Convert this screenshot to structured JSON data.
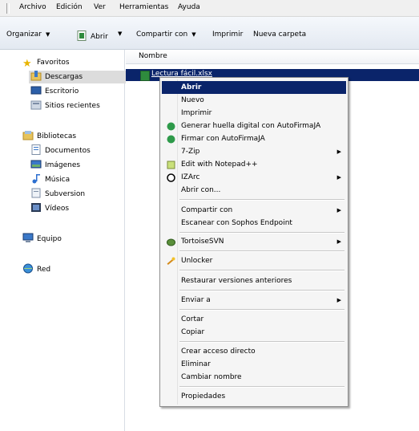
{
  "menubar": {
    "items": [
      "Archivo",
      "Edición",
      "Ver",
      "Herramientas",
      "Ayuda"
    ]
  },
  "toolbar": {
    "organize": "Organizar",
    "open": "Abrir",
    "share": "Compartir con",
    "print": "Imprimir",
    "new_folder": "Nueva carpeta"
  },
  "nav": {
    "favorites": "Favoritos",
    "downloads": "Descargas",
    "desktop": "Escritorio",
    "recent": "Sitios recientes",
    "libraries": "Bibliotecas",
    "documents": "Documentos",
    "images": "Imágenes",
    "music": "Música",
    "subversion": "Subversion",
    "videos": "Vídeos",
    "computer": "Equipo",
    "network": "Red"
  },
  "content": {
    "column_name": "Nombre",
    "file_name": "Lectura fácil.xlsx"
  },
  "context_menu": {
    "open": "Abrir",
    "new": "Nuevo",
    "print": "Imprimir",
    "hash": "Generar huella digital con AutoFirmaJA",
    "sign": "Firmar con AutoFirmaJA",
    "zip": "7-Zip",
    "notepad": "Edit with Notepad++",
    "izarc": "IZArc",
    "open_with": "Abrir con...",
    "share": "Compartir con",
    "sophos": "Escanear con Sophos Endpoint",
    "tortoise": "TortoiseSVN",
    "unlocker": "Unlocker",
    "restore": "Restaurar versiones anteriores",
    "send_to": "Enviar a",
    "cut": "Cortar",
    "copy": "Copiar",
    "shortcut": "Crear acceso directo",
    "delete": "Eliminar",
    "rename": "Cambiar nombre",
    "properties": "Propiedades"
  },
  "colors": {
    "selection": "#0a246a",
    "menu_bg": "#f5f5f5"
  }
}
